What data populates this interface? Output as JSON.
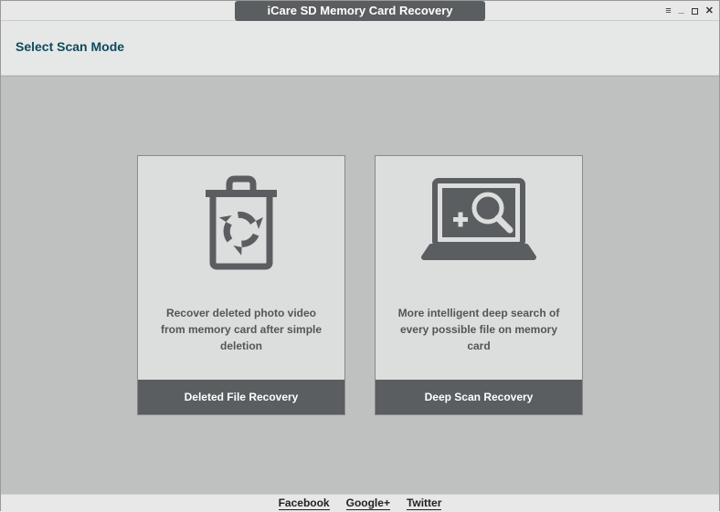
{
  "window": {
    "title": "iCare SD Memory Card Recovery"
  },
  "subheader": {
    "label": "Select Scan Mode"
  },
  "cards": [
    {
      "description": "Recover deleted photo video from memory card after simple deletion",
      "title": "Deleted File Recovery"
    },
    {
      "description": "More intelligent deep search of every possible file on memory card",
      "title": "Deep Scan Recovery"
    }
  ],
  "footer": {
    "links": [
      "Facebook",
      "Google+",
      "Twitter"
    ]
  }
}
